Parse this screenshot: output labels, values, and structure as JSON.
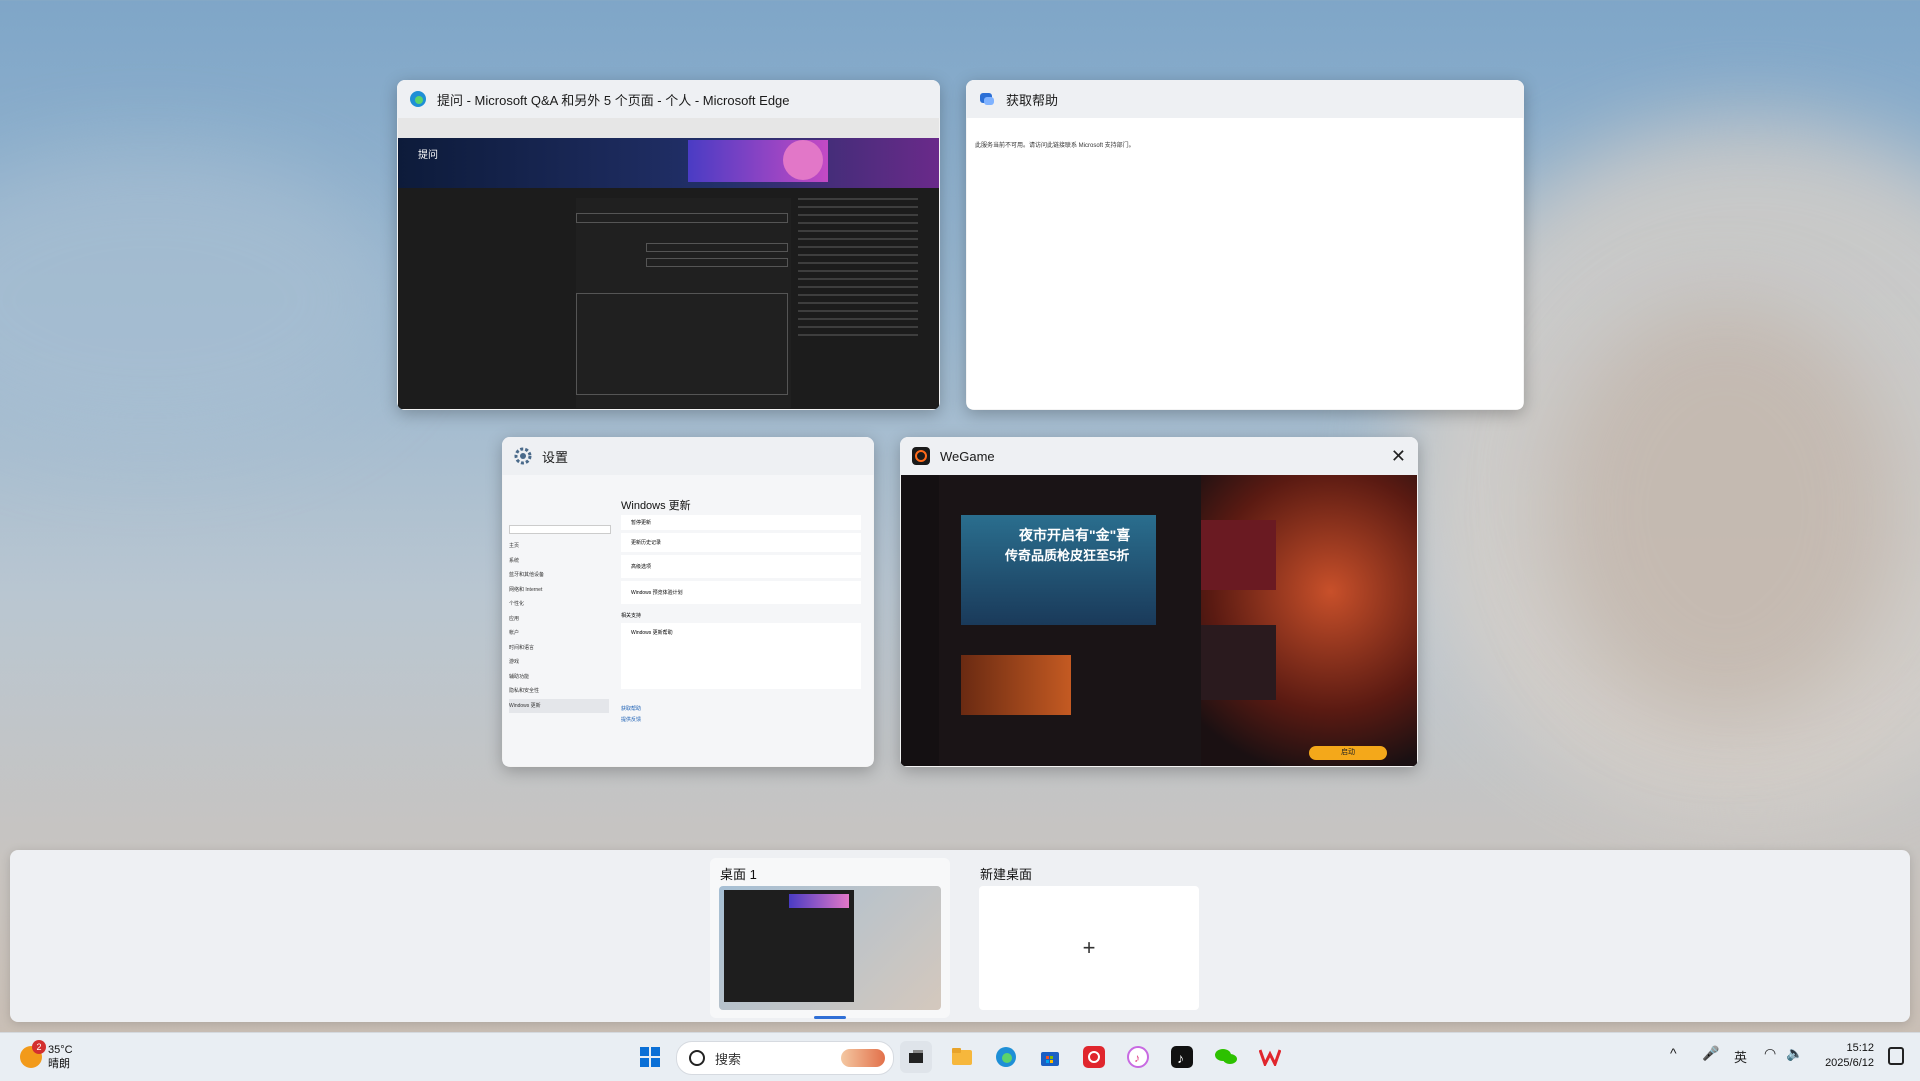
{
  "windows": {
    "edge": {
      "title": "提问 - Microsoft Q&A 和另外 5 个页面 - 个人 - Microsoft Edge",
      "page_heading": "提问"
    },
    "help": {
      "title": "获取帮助",
      "body_text": "此服务当前不可用。请访问此链接联系 Microsoft 支持部门。"
    },
    "settings": {
      "title": "设置",
      "page_heading": "Windows 更新",
      "nav_items": [
        "主页",
        "系统",
        "蓝牙和其他设备",
        "网络和 Internet",
        "个性化",
        "应用",
        "帐户",
        "时间和语言",
        "游戏",
        "辅助功能",
        "隐私和安全性",
        "Windows 更新"
      ],
      "rows": [
        "暂停更新",
        "更新历史记录",
        "高级选项",
        "Windows 预览体验计划"
      ],
      "related_heading": "相关支持",
      "help_row": "Windows 更新帮助",
      "footer": [
        "获取帮助",
        "提供反馈"
      ]
    },
    "wegame": {
      "title": "WeGame",
      "banner_text": "夜市开启有\"金\"喜",
      "banner_sub": "传奇品质枪皮狂至5折",
      "button": "启动"
    }
  },
  "desktops": {
    "desktop1_label": "桌面 1",
    "new_label": "新建桌面",
    "plus": "+"
  },
  "taskbar": {
    "weather": {
      "temp": "35°C",
      "condition": "晴朗",
      "badge": "2"
    },
    "search_placeholder": "搜索",
    "tray": {
      "ime": "英",
      "time": "15:12",
      "date": "2025/6/12"
    }
  },
  "icons": [
    "windows-start-icon",
    "search-icon",
    "task-view-icon",
    "file-explorer-icon",
    "edge-icon",
    "store-icon",
    "netease-music-icon",
    "itunes-icon",
    "tiktok-icon",
    "wechat-icon",
    "wps-icon"
  ]
}
